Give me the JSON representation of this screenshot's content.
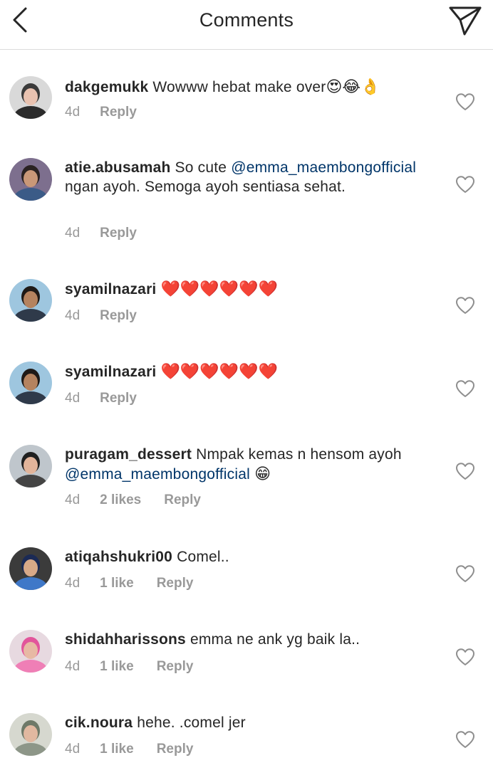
{
  "header": {
    "title": "Comments",
    "back_icon": "chevron-left-icon",
    "share_icon": "paper-plane-icon"
  },
  "colors": {
    "text": "#262626",
    "secondary": "#999999",
    "mention": "#003569",
    "divider": "#dbdbdb"
  },
  "comments": [
    {
      "username": "dakgemukk",
      "parts": [
        {
          "text": "Wowww hebat make over"
        },
        {
          "text": "😍😂👌",
          "emoji": true
        }
      ],
      "time": "4d",
      "likes": "",
      "reply": "Reply"
    },
    {
      "username": "atie.abusamah",
      "parts": [
        {
          "text": "So cute "
        },
        {
          "text": "@emma_maembongofficial",
          "mention": true
        },
        {
          "text": " ngan ayoh. Semoga ayoh sentiasa sehat."
        }
      ],
      "time": "4d",
      "likes": "",
      "reply": "Reply"
    },
    {
      "username": "syamilnazari",
      "parts": [
        {
          "text": "❤️❤️❤️❤️❤️❤️",
          "emoji": true
        }
      ],
      "time": "4d",
      "likes": "",
      "reply": "Reply"
    },
    {
      "username": "syamilnazari",
      "parts": [
        {
          "text": "❤️❤️❤️❤️❤️❤️",
          "emoji": true
        }
      ],
      "time": "4d",
      "likes": "",
      "reply": "Reply"
    },
    {
      "username": "puragam_dessert",
      "parts": [
        {
          "text": "Nmpak kemas n hensom ayoh "
        },
        {
          "text": "@emma_maembongofficial",
          "mention": true
        },
        {
          "text": " 😁",
          "emoji": true
        }
      ],
      "time": "4d",
      "likes": "2 likes",
      "reply": "Reply"
    },
    {
      "username": "atiqahshukri00",
      "parts": [
        {
          "text": "Comel.."
        }
      ],
      "time": "4d",
      "likes": "1 like",
      "reply": "Reply"
    },
    {
      "username": "shidahharissons",
      "parts": [
        {
          "text": "emma ne ank yg baik la.."
        }
      ],
      "time": "4d",
      "likes": "1 like",
      "reply": "Reply"
    },
    {
      "username": "cik.noura",
      "parts": [
        {
          "text": "hehe. .comel jer"
        }
      ],
      "time": "4d",
      "likes": "1 like",
      "reply": "Reply"
    }
  ]
}
